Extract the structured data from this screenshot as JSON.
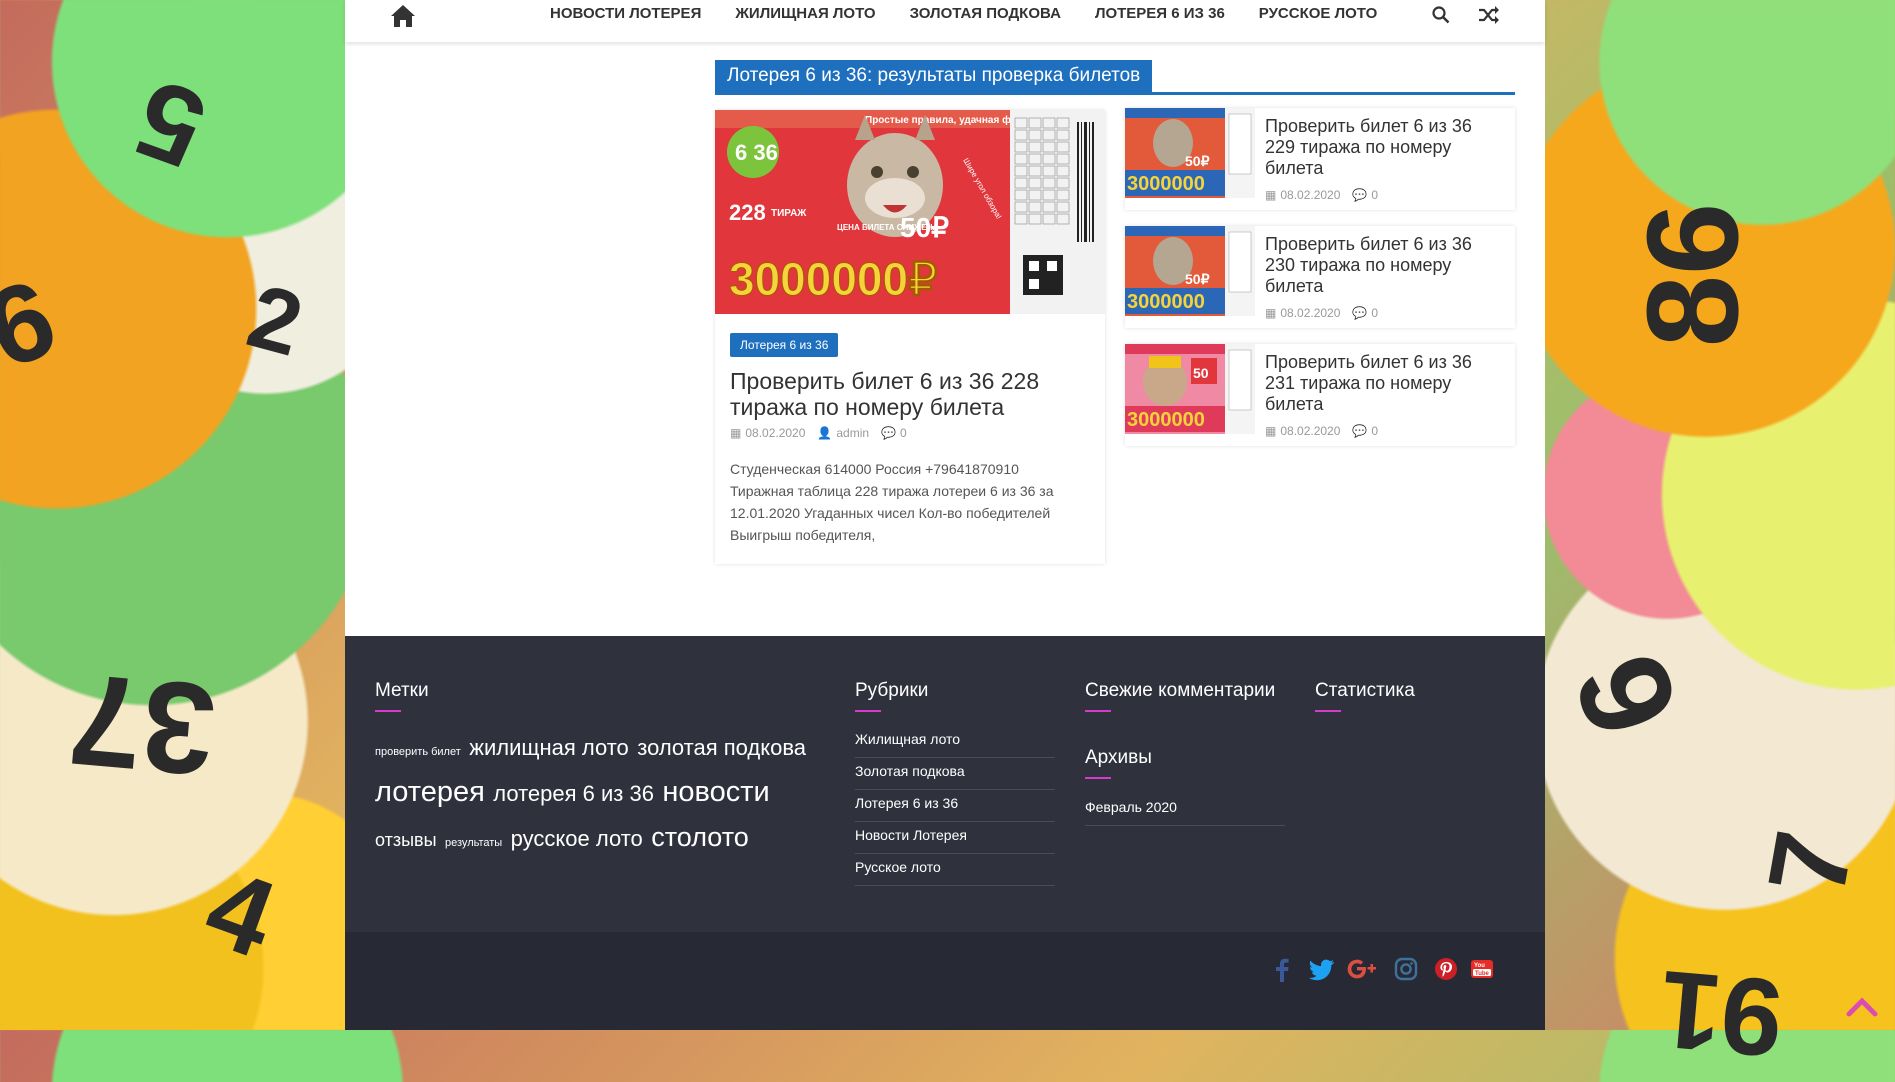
{
  "nav": {
    "items": [
      "НОВОСТИ ЛОТЕРЕЯ",
      "ЖИЛИЩНАЯ ЛОТО",
      "ЗОЛОТАЯ ПОДКОВА",
      "ЛОТЕРЕЯ 6 ИЗ 36",
      "РУССКОЕ ЛОТО"
    ]
  },
  "section_title": "Лотерея 6 из 36: результаты проверка билетов",
  "featured": {
    "category": "Лотерея 6 из 36",
    "title": "Проверить билет 6 из 36 228 тиража по номеру билета",
    "date": "08.02.2020",
    "author": "admin",
    "comments": "0",
    "excerpt": "Студенческая 614000 Россия +79641870910 Тиражная таблица 228 тиража лотереи 6 из 36 за 12.01.2020 Угаданных чисел Кол-во победителей Выигрыш победителя,",
    "ticket": {
      "slogan": "Простые правила, удачная формула!",
      "logo": "6 36",
      "draw_number": "228",
      "draw_label": "ТИРАЖ",
      "price_note": "ЦЕНА БИЛЕТА СНИЖЕНА",
      "price": "50₽",
      "jackpot": "3000000₽",
      "stamp": "Шире угол обзора!"
    }
  },
  "side_posts": [
    {
      "title": "Проверить билет 6 из 36 229 тиража по номеру билета",
      "date": "08.02.2020",
      "comments": "0",
      "thumb_price": "50₽",
      "thumb_jackpot": "3000000"
    },
    {
      "title": "Проверить билет 6 из 36 230 тиража по номеру билета",
      "date": "08.02.2020",
      "comments": "0",
      "thumb_price": "50₽",
      "thumb_jackpot": "3000000"
    },
    {
      "title": "Проверить билет 6 из 36 231 тиража по номеру билета",
      "date": "08.02.2020",
      "comments": "0",
      "thumb_price": "50",
      "thumb_jackpot": "3000000"
    }
  ],
  "footer": {
    "tags_title": "Метки",
    "tags": [
      {
        "text": "проверить билет",
        "size": "small"
      },
      {
        "text": "жилищная лото",
        "size": "large"
      },
      {
        "text": "золотая подкова",
        "size": "large"
      },
      {
        "text": "лотерея",
        "size": "xlarge"
      },
      {
        "text": "лотерея 6 из 36",
        "size": "large"
      },
      {
        "text": "новости",
        "size": "xlarge"
      },
      {
        "text": "отзывы",
        "size": "medium"
      },
      {
        "text": "результаты",
        "size": "small"
      },
      {
        "text": "русское лото",
        "size": "large"
      },
      {
        "text": "столото",
        "size": "xlarge"
      }
    ],
    "categories_title": "Рубрики",
    "categories": [
      "Жилищная лото",
      "Золотая подкова",
      "Лотерея 6 из 36",
      "Новости Лотерея",
      "Русское лото"
    ],
    "comments_title": "Свежие комментарии",
    "archives_title": "Архивы",
    "archives": [
      "Февраль 2020"
    ],
    "stats_title": "Статистика"
  },
  "colors": {
    "accent": "#1e70bf",
    "footer_bg": "#2f313d",
    "footer_bottom": "#272934",
    "underline": "#d63acb",
    "facebook": "#3b5998",
    "twitter": "#1da1f2",
    "googleplus": "#dc4e41",
    "instagram": "#3f729b",
    "pinterest": "#cb2027",
    "youtube": "#e52d27"
  },
  "background_numbers": [
    "5",
    "9",
    "2",
    "86",
    "37",
    "4",
    "6",
    "7",
    "91"
  ]
}
